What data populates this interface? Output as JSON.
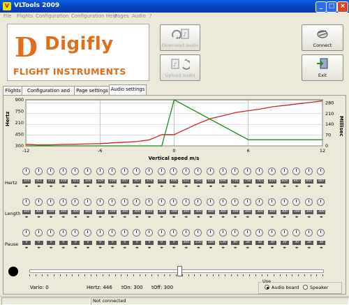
{
  "window": {
    "title": "VLTools 2009",
    "icon": "app-icon"
  },
  "menu": [
    "File",
    "Flights",
    "Configuration",
    "Configuration Help",
    "Pages",
    "Audio",
    "?"
  ],
  "logo": {
    "letter": "D",
    "name": "Digifly",
    "subtitle": "FLIGHT INSTRUMENTS"
  },
  "buttons": {
    "download": "Download audio",
    "upload": "Upload audio",
    "connect": "Connect",
    "exit": "Exit"
  },
  "tabs": [
    "Flights",
    "Configuration and Help",
    "Page settings",
    "Audio settings"
  ],
  "active_tab": 3,
  "chart_data": {
    "type": "line",
    "xlabel": "Vertical speed m/s",
    "ylabel_left": "Hertz",
    "ylabel_right": "Millisec",
    "x_ticks": [
      "-12",
      "-6",
      "0",
      "6",
      "12"
    ],
    "y_left_ticks": [
      "900",
      "750",
      "450",
      "300"
    ],
    "y_left_ticks_extra": [
      "210",
      "600"
    ],
    "y_right_ticks": [
      "280",
      "210",
      "140",
      "70",
      "0"
    ],
    "xlim": [
      -12,
      12
    ],
    "ylim_left": [
      300,
      900
    ],
    "ylim_right": [
      0,
      300
    ],
    "series": [
      {
        "color": "#d22222",
        "axis": "left",
        "x": [
          -12,
          -11,
          -10,
          -9,
          -8,
          -7,
          -6,
          -5,
          -4,
          -3,
          -2,
          -1,
          0,
          1,
          2,
          3,
          4,
          5,
          6,
          7,
          8,
          9,
          10,
          11,
          12
        ],
        "values": [
          320,
          312,
          313,
          318,
          321,
          326,
          329,
          339,
          347,
          357,
          379,
          446,
          446,
          521,
          595,
          658,
          694,
          735,
          758,
          781,
          810,
          828,
          847,
          866,
          887
        ]
      },
      {
        "color": "#1a8a1a",
        "axis": "right",
        "x": [
          -12,
          -1,
          0,
          6,
          7,
          12
        ],
        "values": [
          0,
          0,
          300,
          40,
          40,
          40
        ]
      }
    ]
  },
  "rows": {
    "hertz": {
      "label": "Hertz",
      "values": [
        "320",
        "311",
        "313",
        "318",
        "321",
        "326",
        "329",
        "339",
        "347",
        "357",
        "379",
        "446",
        "446",
        "521",
        "595",
        "658",
        "694",
        "735",
        "758",
        "781",
        "810",
        "828",
        "847",
        "866",
        "887"
      ]
    },
    "length": {
      "label": "Length",
      "values": [
        "300",
        "300",
        "300",
        "300",
        "300",
        "300",
        "300",
        "300",
        "300",
        "300",
        "300",
        "300",
        "300",
        "300",
        "300",
        "300",
        "300",
        "300",
        "300",
        "300",
        "300",
        "300",
        "300",
        "300",
        "300"
      ]
    },
    "pause": {
      "label": "Pause",
      "values": [
        "0",
        "0",
        "0",
        "0",
        "0",
        "0",
        "0",
        "0",
        "0",
        "0",
        "0",
        "0",
        "0",
        "300",
        "230",
        "180",
        "130",
        "80",
        "30",
        "30",
        "30",
        "30",
        "30",
        "30",
        "30"
      ]
    }
  },
  "readout": {
    "vario": "Vario:  0",
    "hertz": "Hertz:  446",
    "ton": "tOn: 300",
    "toff": "tOff:  300"
  },
  "use": {
    "label": "Use",
    "audio_board": "Audio board",
    "speaker": "Speaker",
    "selected": "Audio board"
  },
  "status": {
    "connection": "Not connected"
  }
}
